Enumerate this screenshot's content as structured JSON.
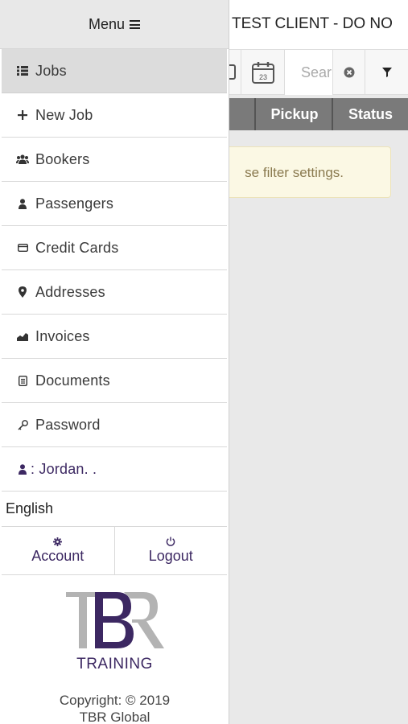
{
  "header": {
    "title": "TEST CLIENT - DO NO"
  },
  "toolbar": {
    "calendar_day": "23",
    "search_placeholder": "Search"
  },
  "table": {
    "columns": [
      "Pickup",
      "Status"
    ]
  },
  "notice": {
    "text": "se filter settings."
  },
  "menu": {
    "title": "Menu",
    "items": [
      {
        "label": "Jobs",
        "icon": "list-icon",
        "active": true
      },
      {
        "label": "New Job",
        "icon": "plus-icon"
      },
      {
        "label": "Bookers",
        "icon": "users-icon"
      },
      {
        "label": "Passengers",
        "icon": "user-icon"
      },
      {
        "label": "Credit Cards",
        "icon": "credit-card-icon"
      },
      {
        "label": "Addresses",
        "icon": "map-marker-icon"
      },
      {
        "label": "Invoices",
        "icon": "chart-area-icon"
      },
      {
        "label": "Documents",
        "icon": "document-icon"
      },
      {
        "label": "Password",
        "icon": "key-icon"
      }
    ],
    "user": {
      "label": ": Jordan. .",
      "icon": "user-icon"
    },
    "language": "English",
    "account_label": "Account",
    "logout_label": "Logout"
  },
  "brand": {
    "logo_letters": "TBR",
    "tagline": "TRAINING",
    "copyright_line1": "Copyright: © 2019",
    "copyright_line2": "TBR Global",
    "accent_color": "#3c2862",
    "gray_color": "#b3b3b3"
  }
}
